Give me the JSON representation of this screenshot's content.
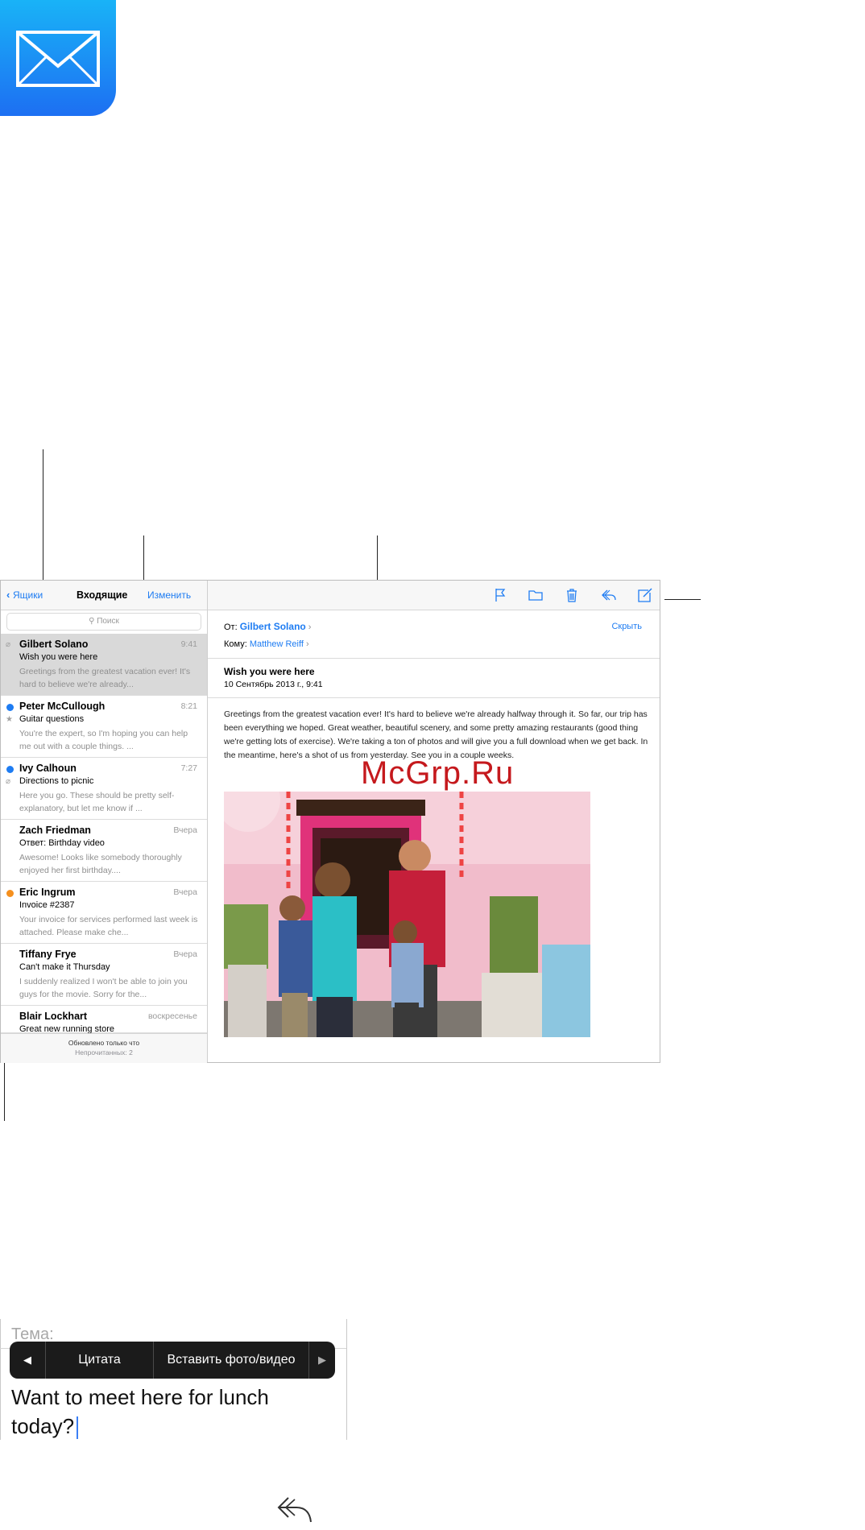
{
  "mailbox": {
    "back_label": "Ящики",
    "title": "Входящие",
    "edit_label": "Изменить",
    "search_placeholder": "Поиск",
    "messages": [
      {
        "sender": "Gilbert Solano",
        "time": "9:41",
        "subject": "Wish you were here",
        "preview": "Greetings from the greatest vacation ever! It's hard to believe we're already...",
        "unread": false,
        "attachment": true,
        "flag": false,
        "selected": true
      },
      {
        "sender": "Peter McCullough",
        "time": "8:21",
        "subject": "Guitar questions",
        "preview": "You're the expert, so I'm hoping you can help me out with a couple things. ...",
        "unread": true,
        "attachment": false,
        "flag": true,
        "selected": false
      },
      {
        "sender": "Ivy Calhoun",
        "time": "7:27",
        "subject": "Directions to picnic",
        "preview": "Here you go. These should be pretty self-explanatory, but let me know if ...",
        "unread": true,
        "attachment": true,
        "flag": false,
        "selected": false
      },
      {
        "sender": "Zach Friedman",
        "time": "Вчера",
        "subject": "Ответ: Birthday video",
        "preview": "Awesome! Looks like somebody thoroughly enjoyed her first birthday....",
        "unread": false,
        "attachment": false,
        "flag": false,
        "selected": false
      },
      {
        "sender": "Eric Ingrum",
        "time": "Вчера",
        "subject": "Invoice #2387",
        "preview": "Your invoice for services performed last week is attached. Please make che...",
        "unread": true,
        "attachment": false,
        "flag": false,
        "selected": false
      },
      {
        "sender": "Tiffany Frye",
        "time": "Вчера",
        "subject": "Can't make it Thursday",
        "preview": "I suddenly realized I won't be able to join you guys for the movie. Sorry for the...",
        "unread": false,
        "attachment": false,
        "flag": false,
        "selected": false
      },
      {
        "sender": "Blair Lockhart",
        "time": "воскресенье",
        "subject": "Great new running store",
        "preview": "",
        "unread": false,
        "attachment": false,
        "flag": false,
        "selected": false
      }
    ],
    "footer_updated": "Обновлено только что",
    "footer_unread": "Непрочитанных: 2"
  },
  "message": {
    "from_label": "От:",
    "from_name": "Gilbert Solano",
    "to_label": "Кому:",
    "to_name": "Matthew Reiff",
    "hide_label": "Скрыть",
    "subject": "Wish you were here",
    "date": "10 Сентябрь 2013 г., 9:41",
    "body": "Greetings from the greatest vacation ever! It's hard to believe we're already halfway through it. So far, our trip has been everything we hoped. Great weather, beautiful scenery, and some pretty amazing restaurants (good thing we're getting lots of exercise). We're taking a ton of photos and will give you a full download when we get back. In the meantime, here's a shot of us from yesterday. See you in a couple weeks."
  },
  "toolbar_icons": [
    "flag-icon",
    "folder-icon",
    "trash-icon",
    "reply-icon",
    "compose-icon"
  ],
  "watermark": "McGrp.Ru",
  "compose": {
    "subject_label": "Тема:",
    "popup_prev": "◀",
    "popup_quote": "Цитата",
    "popup_insert": "Вставить фото/видео",
    "popup_next": "▶",
    "text_line1": "Want to meet here for lunch",
    "text_line2": "today?"
  },
  "colors": {
    "accent": "#1e7cf2",
    "unread_dot": "#1e7cf2",
    "orange_dot": "#f5901e"
  }
}
